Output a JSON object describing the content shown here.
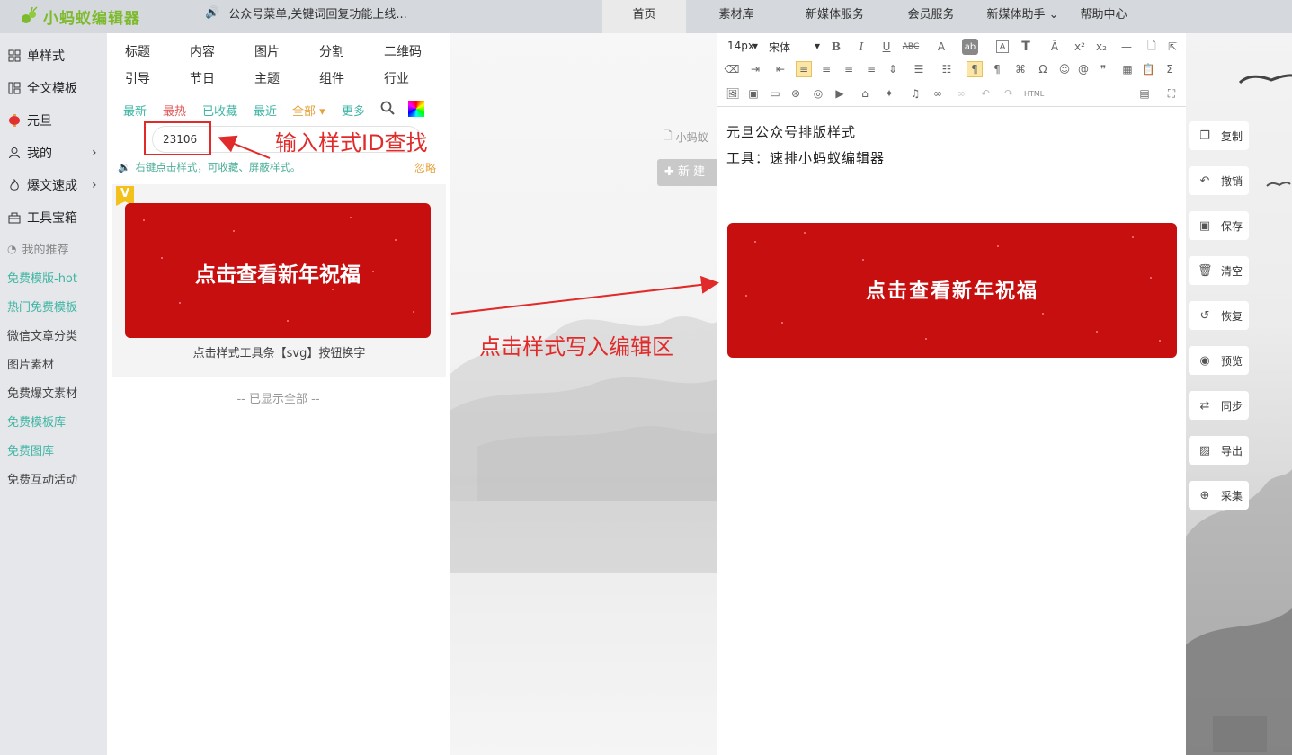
{
  "app": {
    "logo_text": "小蚂蚁编辑器",
    "notice": "公众号菜单,关键词回复功能上线...",
    "nav": [
      {
        "label": "首页"
      },
      {
        "label": "素材库"
      },
      {
        "label": "新媒体服务"
      },
      {
        "label": "会员服务"
      },
      {
        "label": "新媒体助手 ⌄"
      },
      {
        "label": "帮助中心"
      }
    ]
  },
  "sidebar": {
    "items": [
      {
        "label": "单样式",
        "icon": "grid-icon"
      },
      {
        "label": "全文模板",
        "icon": "layout-icon"
      },
      {
        "label": "元旦",
        "icon": "lantern-icon"
      },
      {
        "label": "我的",
        "icon": "user-icon"
      },
      {
        "label": "爆文速成",
        "icon": "fire-icon"
      },
      {
        "label": "工具宝箱",
        "icon": "toolbox-icon"
      }
    ],
    "recommend_label": "我的推荐",
    "links": [
      {
        "label": "免费模版-hot"
      },
      {
        "label": "热门免费模板"
      },
      {
        "label": "微信文章分类"
      },
      {
        "label": "图片素材"
      },
      {
        "label": "免费爆文素材"
      },
      {
        "label": "免费模板库"
      },
      {
        "label": "免费图库"
      },
      {
        "label": "免费互动活动"
      }
    ]
  },
  "panel": {
    "categories_row1": [
      "标题",
      "内容",
      "图片",
      "分割",
      "二维码"
    ],
    "categories_row2": [
      "引导",
      "节日",
      "主题",
      "组件",
      "行业"
    ],
    "filters": [
      "最新",
      "最热",
      "已收藏",
      "最近",
      "全部 ▾",
      "更多"
    ],
    "search_value": "23106",
    "tip": "右键点击样式，可收藏、屏蔽样式。",
    "ignore": "忽略",
    "card_badge": "V",
    "card_text": "点击查看新年祝福",
    "card_caption": "点击样式工具条【svg】按钮换字",
    "shown_all": "-- 已显示全部 --"
  },
  "middle": {
    "file_label": "小蚂蚁",
    "new_button": "新 建"
  },
  "editor": {
    "font_size": "14px",
    "font_family": "宋体",
    "html_label": "HTML",
    "line1": "元旦公众号排版样式",
    "line2": "工具：速排小蚂蚁编辑器",
    "card_text": "点击查看新年祝福"
  },
  "right_actions": [
    {
      "label": "复制",
      "icon": "copy-icon"
    },
    {
      "label": "撤销",
      "icon": "undo-icon"
    },
    {
      "label": "保存",
      "icon": "save-icon"
    },
    {
      "label": "清空",
      "icon": "trash-icon"
    },
    {
      "label": "恢复",
      "icon": "restore-icon"
    },
    {
      "label": "预览",
      "icon": "eye-icon"
    },
    {
      "label": "同步",
      "icon": "sync-icon"
    },
    {
      "label": "导出",
      "icon": "export-icon"
    },
    {
      "label": "采集",
      "icon": "zoom-icon"
    }
  ],
  "annotations": {
    "search_hint": "输入样式ID查找",
    "write_hint": "点击样式写入编辑区"
  },
  "colors": {
    "brand_green": "#7dba2c",
    "accent_teal": "#3fb5a4",
    "card_red": "#c80f10",
    "annotation_red": "#e12a2a",
    "filter_hot": "#e05a5a",
    "filter_all": "#e6a23c"
  }
}
